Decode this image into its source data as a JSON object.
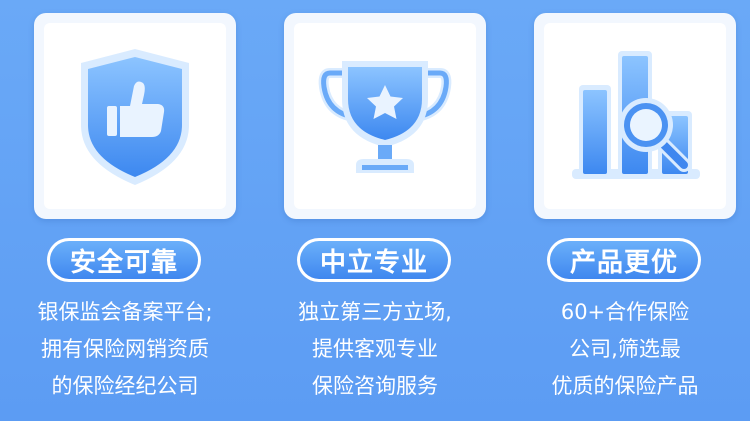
{
  "features": [
    {
      "title": "安全可靠",
      "icon": "shield-thumbs-up-icon",
      "lines": [
        "银保监会备案平台;",
        "拥有保险网销资质",
        "的保险经纪公司"
      ]
    },
    {
      "title": "中立专业",
      "icon": "trophy-star-icon",
      "lines": [
        "独立第三方立场,",
        "提供客观专业",
        "保险咨询服务"
      ]
    },
    {
      "title": "产品更优",
      "icon": "bar-chart-magnifier-icon",
      "lines": [
        "60+合作保险",
        "公司,筛选最",
        "优质的保险产品"
      ]
    }
  ],
  "colors": {
    "background": "#5c9cf3",
    "pill": "#3f87ef",
    "icon": "#5fa3f7",
    "icon_light": "#d9ebff",
    "text": "#ffffff"
  }
}
